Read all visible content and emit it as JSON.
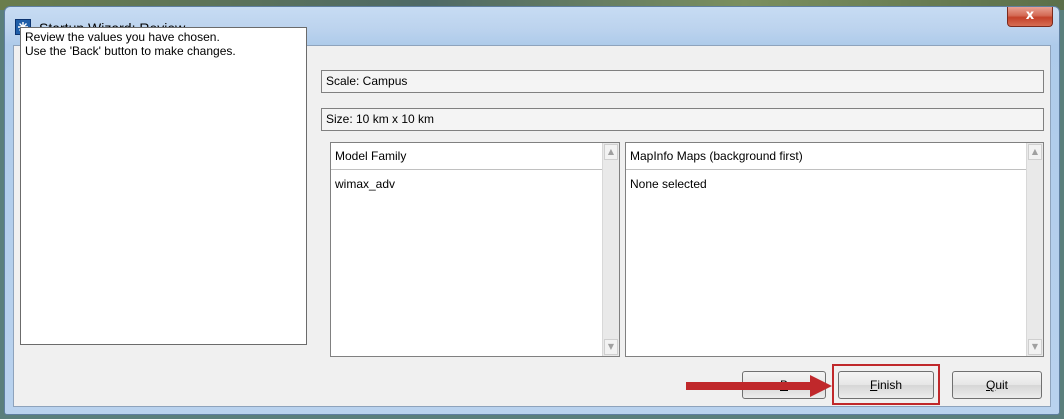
{
  "window": {
    "title": "Startup Wizard: Review",
    "close_label": "x"
  },
  "instructions": {
    "line1": "Review the values you have chosen.",
    "line2": "Use the 'Back' button to make changes."
  },
  "fields": {
    "scale": "Scale: Campus",
    "size": "Size: 10 km x 10 km"
  },
  "model_family": {
    "header": "Model Family",
    "items": [
      "wimax_adv"
    ]
  },
  "maps": {
    "header": "MapInfo Maps (background first)",
    "items": [
      "None selected"
    ]
  },
  "buttons": {
    "back_label": "B",
    "finish_first": "F",
    "finish_rest": "inish",
    "quit_first": "Q",
    "quit_rest": "uit"
  },
  "icons": {
    "scroll_up": "scroll-up-arrow-icon",
    "scroll_down": "scroll-down-arrow-icon",
    "annotation": "red-arrow-icon"
  },
  "colors": {
    "highlight": "#c0282b",
    "close_button": "#c4412a"
  }
}
